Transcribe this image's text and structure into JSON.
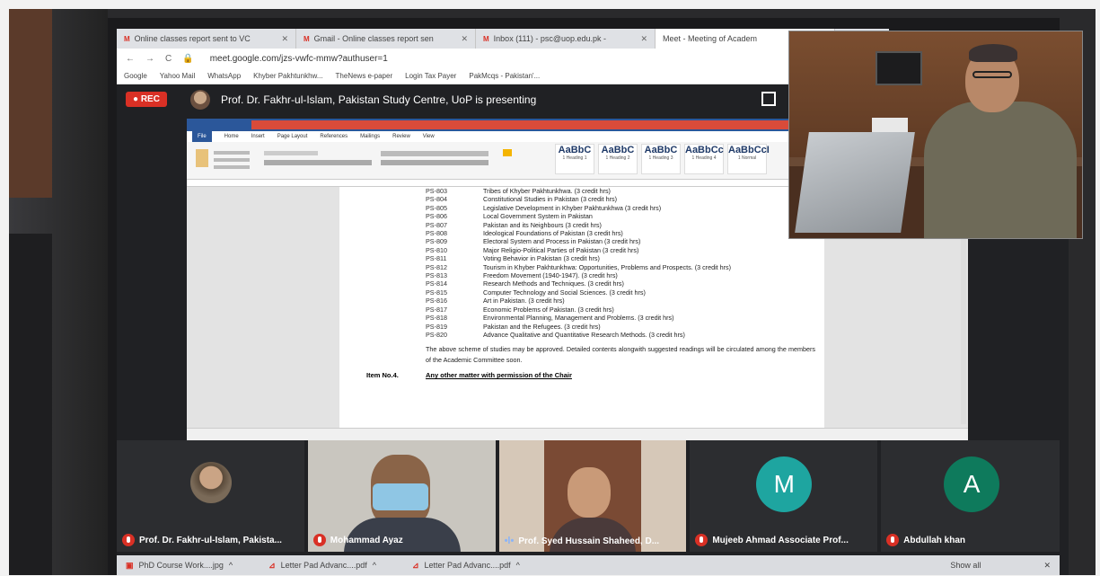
{
  "browser": {
    "tabs": [
      {
        "label": "Online classes report sent to VC",
        "icon": "gmail-icon",
        "active": false
      },
      {
        "label": "Gmail - Online classes report sen",
        "icon": "gmail-icon",
        "active": false
      },
      {
        "label": "Inbox (111) - psc@uop.edu.pk - ",
        "icon": "gmail-icon",
        "active": false
      },
      {
        "label": "Meet - Meeting of Academ",
        "icon": "meet-icon",
        "active": true
      }
    ],
    "url": "meet.google.com/jzs-vwfc-mmw?authuser=1",
    "bookmarks": [
      "Google",
      "Yahoo Mail",
      "WhatsApp",
      "Khyber Pakhtunkhw...",
      "TheNews e-paper",
      "Login Tax Payer",
      "PakMcqs - Pakistan'..."
    ]
  },
  "meet": {
    "rec_label": "REC",
    "presenting_text": "Prof. Dr. Fakhr-ul-Islam, Pakistan Study Centre, UoP is presenting",
    "participants": [
      {
        "name": "Prof. Dr. Fakhr-ul-Islam, Pakista...",
        "muted": true,
        "type": "photo"
      },
      {
        "name": "Mohammad Ayaz",
        "muted": true,
        "type": "video"
      },
      {
        "name": "Prof. Syed Hussain Shaheed, D...",
        "muted": false,
        "type": "video"
      },
      {
        "name": "Mujeeb Ahmad Associate Prof...",
        "muted": true,
        "type": "letter",
        "letter": "M",
        "color": "#1ea5a0"
      },
      {
        "name": "Abdullah khan",
        "muted": true,
        "type": "letter",
        "letter": "A",
        "color": "#0e7a5c"
      }
    ]
  },
  "word": {
    "tabs": [
      "File",
      "Home",
      "Insert",
      "Page Layout",
      "References",
      "Mailings",
      "Review",
      "View"
    ],
    "styles": [
      {
        "sample": "AaBbC",
        "name": "1 Heading 1"
      },
      {
        "sample": "AaBbC",
        "name": "1 Heading 2"
      },
      {
        "sample": "AaBbC",
        "name": "1 Heading 3"
      },
      {
        "sample": "AaBbCc",
        "name": "1 Heading 4"
      },
      {
        "sample": "AaBbCcI",
        "name": "1 Normal"
      }
    ],
    "courses": [
      {
        "code": "PS-803",
        "title": "Tribes of Khyber Pakhtunkhwa. (3 credit hrs)"
      },
      {
        "code": "PS-804",
        "title": "Constitutional Studies in Pakistan (3 credit hrs)"
      },
      {
        "code": "PS-805",
        "title": "Legislative Development in Khyber Pakhtunkhwa (3 credit hrs)"
      },
      {
        "code": "PS-806",
        "title": "Local Government System in Pakistan"
      },
      {
        "code": "PS-807",
        "title": "Pakistan and its Neighbours (3 credit hrs)"
      },
      {
        "code": "PS-808",
        "title": "Ideological Foundations of Pakistan (3 credit hrs)"
      },
      {
        "code": "PS-809",
        "title": "Electoral System and Process in Pakistan (3 credit hrs)"
      },
      {
        "code": "PS-810",
        "title": "Major Religio-Political Parties of Pakistan (3 credit hrs)"
      },
      {
        "code": "PS-811",
        "title": "Voting Behavior in Pakistan (3 credit hrs)"
      },
      {
        "code": "PS-812",
        "title": "Tourism in Khyber Pakhtunkhwa: Opportunities, Problems and Prospects. (3 credit hrs)"
      },
      {
        "code": "PS-813",
        "title": "Freedom Movement (1940-1947). (3 credit hrs)"
      },
      {
        "code": "PS-814",
        "title": "Research Methods and Techniques. (3 credit hrs)"
      },
      {
        "code": "PS-815",
        "title": "Computer Technology and Social Sciences. (3 credit hrs)"
      },
      {
        "code": "PS-816",
        "title": "Art in Pakistan. (3 credit hrs)"
      },
      {
        "code": "PS-817",
        "title": "Economic Problems of Pakistan. (3 credit hrs)"
      },
      {
        "code": "PS-818",
        "title": "Environmental Planning, Management and Problems. (3 credit hrs)"
      },
      {
        "code": "PS-819",
        "title": "Pakistan and the Refugees. (3 credit hrs)"
      },
      {
        "code": "PS-820",
        "title": "Advance Qualitative and Quantitative Research Methods. (3 credit hrs)"
      }
    ],
    "paragraph": "The above scheme of studies may be approved. Detailed contents alongwith suggested readings will be circulated among the members of the Academic Committee soon.",
    "item_label": "Item No.4.",
    "item_text": "Any other matter with permission of the Chair"
  },
  "downloads": {
    "items": [
      "PhD Course Work....jpg",
      "Letter Pad Advanc....pdf",
      "Letter Pad Advanc....pdf"
    ],
    "show_all": "Show all"
  }
}
